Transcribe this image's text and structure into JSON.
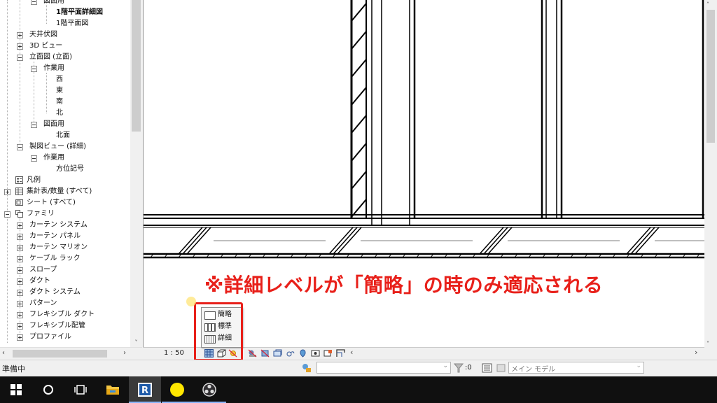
{
  "browser": {
    "items": [
      {
        "label": "図面用"
      },
      {
        "label": "1階平面詳細図"
      },
      {
        "label": "1階平面図"
      },
      {
        "label": "天井伏図"
      },
      {
        "label": "3D ビュー"
      },
      {
        "label": "立面図 (立面)"
      },
      {
        "label": "作業用"
      },
      {
        "label": "西"
      },
      {
        "label": "東"
      },
      {
        "label": "南"
      },
      {
        "label": "北"
      },
      {
        "label": "図面用"
      },
      {
        "label": "北面"
      },
      {
        "label": "製図ビュー (詳細)"
      },
      {
        "label": "作業用"
      },
      {
        "label": "方位記号"
      },
      {
        "label": "凡例"
      },
      {
        "label": "集計表/数量 (すべて)"
      },
      {
        "label": "シート (すべて)"
      },
      {
        "label": "ファミリ"
      },
      {
        "label": "カーテン システム"
      },
      {
        "label": "カーテン パネル"
      },
      {
        "label": "カーテン マリオン"
      },
      {
        "label": "ケーブル ラック"
      },
      {
        "label": "スロープ"
      },
      {
        "label": "ダクト"
      },
      {
        "label": "ダクト システム"
      },
      {
        "label": "パターン"
      },
      {
        "label": "フレキシブル ダクト"
      },
      {
        "label": "フレキシブル配管"
      },
      {
        "label": "プロファイル"
      }
    ]
  },
  "view_control": {
    "scale": "1 : 50"
  },
  "detail_menu": {
    "items": [
      {
        "label": "簡略"
      },
      {
        "label": "標準"
      },
      {
        "label": "詳細"
      }
    ]
  },
  "annotation": "※詳細レベルが「簡略」の時のみ適応される",
  "status_bar": {
    "status_text": "準備中",
    "selection_count": ":0",
    "model_label": "メイン モデル"
  },
  "colors": {
    "annotation": "#e8201a",
    "taskbar": "#101010",
    "sticky_note": "#ffe600"
  },
  "icons": [
    "windows-start-icon",
    "search-circle-icon",
    "task-view-icon",
    "file-explorer-icon",
    "revit-icon",
    "yellow-circle-app-icon",
    "obs-icon"
  ]
}
